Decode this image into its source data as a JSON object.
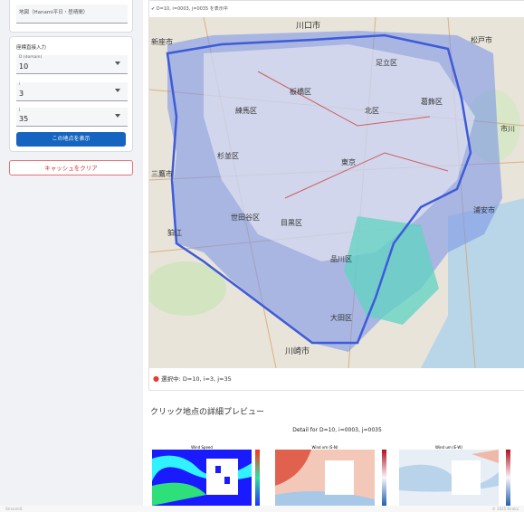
{
  "sidebar": {
    "top_select_value": "地図（Hanami平日・昼晴間）",
    "coord_section_title": "座標直接入力",
    "select_d": {
      "label": "D (domain)",
      "value": "10"
    },
    "select_i": {
      "label": "i",
      "value": "3"
    },
    "select_j": {
      "label": "j",
      "value": "35"
    },
    "show_button": "この地点を表示",
    "clear_cache_button": "キャッシュをクリア"
  },
  "map": {
    "status_text": "D=10, i=0003, j=0035 を表示中",
    "place_labels": [
      "川口市",
      "松戸市",
      "新座市",
      "足立区",
      "板橋区",
      "葛飾区",
      "練馬区",
      "北区",
      "杉並区",
      "市川",
      "三鷹市",
      "世田谷区",
      "目黒区",
      "品川区",
      "大田区",
      "狛江",
      "川崎市",
      "浦安市",
      "東京"
    ],
    "selection_text": "選択中: D=10, i=3, j=35"
  },
  "preview": {
    "heading": "クリック地点の詳細プレビュー",
    "figure_title": "Detail for D=10, i=0003, j=0035",
    "panels": [
      {
        "title": "Wind Speed"
      },
      {
        "title": "Wind vm (S-N)"
      },
      {
        "title": "Wind um (E-W)"
      }
    ]
  },
  "footer": {
    "left": "Streamlit",
    "right": "© 2025 Kiroku"
  },
  "colors": {
    "primary": "#1565c0",
    "danger": "#d32f2f",
    "selection_dot": "#e53935"
  }
}
